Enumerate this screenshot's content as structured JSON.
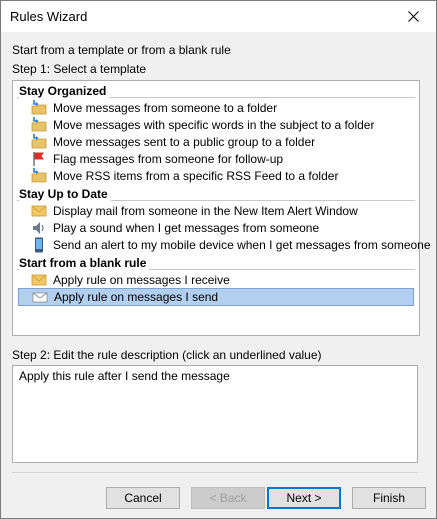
{
  "window": {
    "title": "Rules Wizard"
  },
  "intro": "Start from a template or from a blank rule",
  "step1": "Step 1: Select a template",
  "groups": [
    {
      "label": "Stay Organized",
      "items": [
        {
          "label": "Move messages from someone to a folder",
          "icon": "folder-move-icon"
        },
        {
          "label": "Move messages with specific words in the subject to a folder",
          "icon": "folder-move-icon"
        },
        {
          "label": "Move messages sent to a public group to a folder",
          "icon": "folder-move-icon"
        },
        {
          "label": "Flag messages from someone for follow-up",
          "icon": "red-flag-icon"
        },
        {
          "label": "Move RSS items from a specific RSS Feed to a folder",
          "icon": "folder-move-icon"
        }
      ]
    },
    {
      "label": "Stay Up to Date",
      "items": [
        {
          "label": "Display mail from someone in the New Item Alert Window",
          "icon": "envelope-alert-icon"
        },
        {
          "label": "Play a sound when I get messages from someone",
          "icon": "speaker-icon"
        },
        {
          "label": "Send an alert to my mobile device when I get messages from someone",
          "icon": "mobile-phone-icon"
        }
      ]
    },
    {
      "label": "Start from a blank rule",
      "items": [
        {
          "label": "Apply rule on messages I receive",
          "icon": "envelope-icon"
        },
        {
          "label": "Apply rule on messages I send",
          "icon": "envelope-send-icon",
          "selected": true
        }
      ]
    }
  ],
  "step2": "Step 2: Edit the rule description (click an underlined value)",
  "description": "Apply this rule after I send the message",
  "buttons": {
    "cancel": "Cancel",
    "back": "< Back",
    "next": "Next >",
    "finish": "Finish"
  },
  "colors": {
    "selection": "#b2cff0",
    "folder": "#e8c36a",
    "arrow": "#2b7bd1",
    "flag": "#d9302c"
  }
}
